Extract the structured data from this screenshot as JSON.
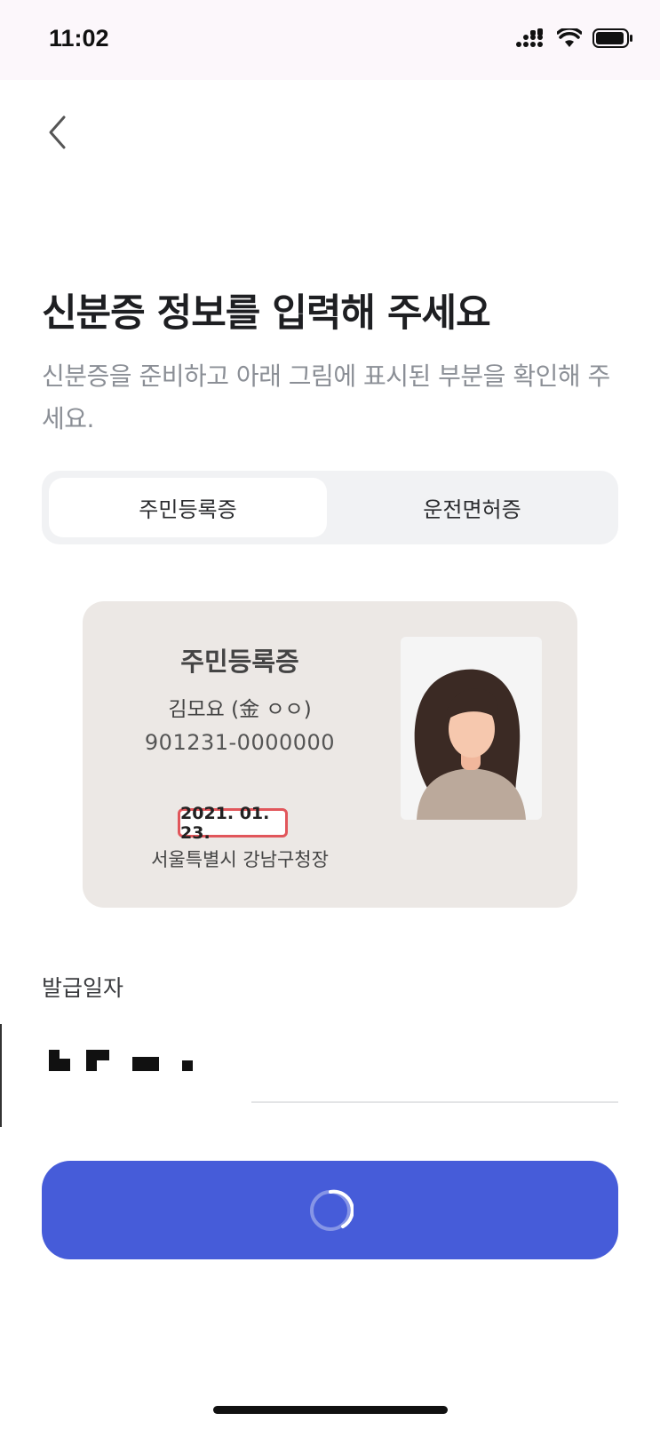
{
  "status_bar": {
    "time": "11:02"
  },
  "header": {
    "back_icon": "chevron-left-icon"
  },
  "title": "신분증 정보를 입력해 주세요",
  "subtitle": "신분증을 준비하고 아래 그림에 표시된 부분을 확인해 주세요.",
  "tabs": [
    {
      "label": "주민등록증",
      "active": true
    },
    {
      "label": "운전면허증",
      "active": false
    }
  ],
  "id_card": {
    "title": "주민등록증",
    "name": "김모요 (金 ㅇㅇ)",
    "number": "901231-0000000",
    "issue_date": "2021. 01. 23.",
    "issuer": "서울특별시 강남구청장"
  },
  "field": {
    "label": "발급일자",
    "value_redacted": true
  },
  "submit_button": {
    "state": "loading"
  },
  "colors": {
    "primary": "#465cd9",
    "highlight": "#e1565b",
    "card_bg": "#ece8e5"
  }
}
